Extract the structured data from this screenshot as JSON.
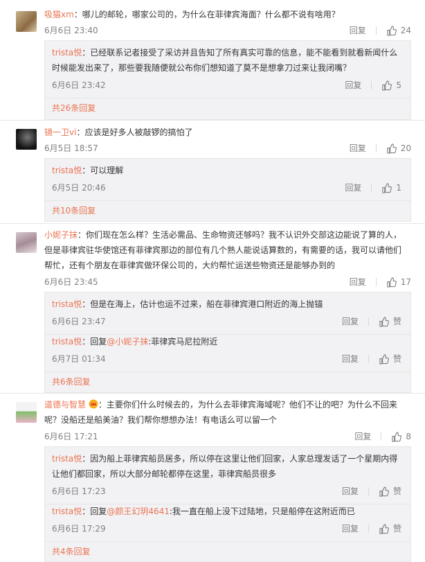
{
  "labels": {
    "reply": "回复",
    "like": "赞"
  },
  "comments": [
    {
      "user": "吸猫xm",
      "text": "：哪儿的邮轮，哪家公司的，为什么在菲律宾海面？什么都不说有啥用？",
      "time": "6月6日 23:40",
      "likes": "24",
      "replies": [
        {
          "user": "trista悦",
          "text": "：已经联系记者接受了采访并且告知了所有真实可靠的信息，能不能看到就看新闻什么时候能发出来了，那些要我随便就公布你们想知道了莫不是想拿刀过来让我闭嘴？",
          "time": "6月6日 23:42",
          "likes": "5"
        }
      ],
      "more": "共26条回复"
    },
    {
      "user": "镜一卫vi",
      "text": "：应该是好多人被敲锣的搞怕了",
      "time": "6月5日 18:57",
      "likes": "20",
      "replies": [
        {
          "user": "trista悦",
          "text": "：可以理解",
          "time": "6月5日 20:46",
          "likes": "1"
        }
      ],
      "more": "共10条回复"
    },
    {
      "user": "小妮子抹",
      "text": "：你们现在怎么样？生活必需品、生命物资还够吗？我不认识外交部这边能说了算的人，但是菲律宾驻华使馆还有菲律宾那边的部位有几个熟人能说话算数的，有需要的话，我可以请他们帮忙，还有个朋友在菲律宾做环保公司的，大约帮忙运送些物资还是能够办到的",
      "time": "6月6日 23:45",
      "likes": "17",
      "replies": [
        {
          "user": "trista悦",
          "text": "：但是在海上，估计也运不过来，船在菲律宾港口附近的海上抛锚",
          "time": "6月6日 23:47",
          "likes": "赞"
        },
        {
          "user": "trista悦",
          "pre": "：回复",
          "mention": "@小妮子抹",
          "text": ":菲律宾马尼拉附近",
          "time": "6月7日 01:34",
          "likes": "赞"
        }
      ],
      "more": "共6条回复"
    },
    {
      "user": "道德与智慧",
      "text": "：主要你们什么时候去的，为什么去菲律宾海域呢？他们不让的吧？为什么不回来呢？没船还是船美油？我们帮你想想办法！有电话么可以留一个",
      "time": "6月6日 17:21",
      "likes": "8",
      "replies": [
        {
          "user": "trista悦",
          "text": "：因为船上菲律宾船员居多，所以停在这里让他们回家，人家总理发话了一个星期内得让他们都回家，所以大部分邮轮都停在这里，菲律宾船员很多",
          "time": "6月6日 17:23",
          "likes": "赞"
        },
        {
          "user": "trista悦",
          "pre": "：回复",
          "mention": "@颜王幻玥4641",
          "text": ":我一直在船上没下过陆地，只是船停在这附近而已",
          "time": "6月6日 17:29",
          "likes": "赞"
        }
      ],
      "more": "共4条回复"
    }
  ]
}
